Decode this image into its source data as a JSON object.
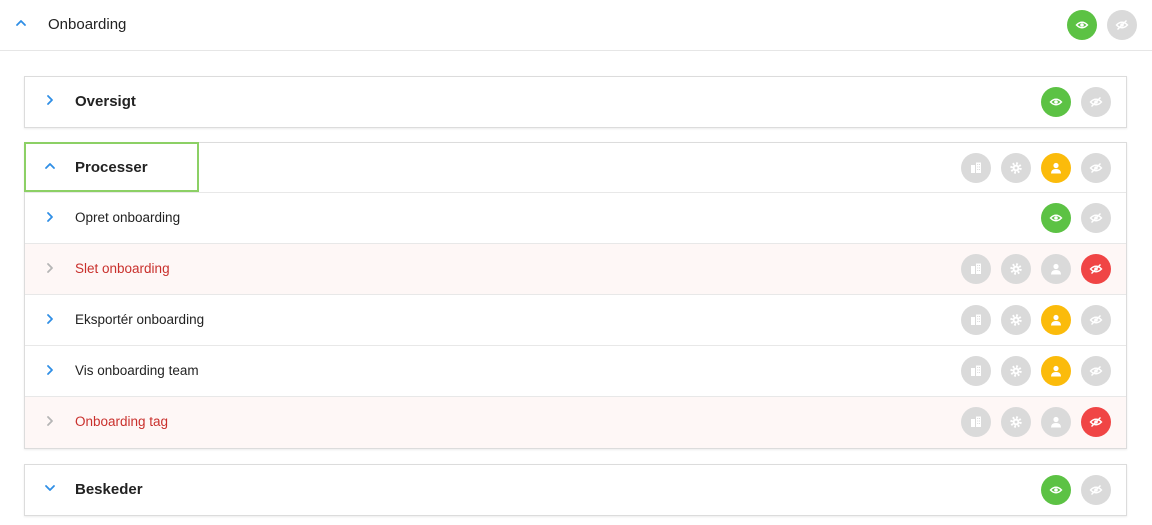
{
  "header": {
    "title": "Onboarding",
    "expanded": true,
    "buttons": [
      "eye-on",
      "eye-off"
    ],
    "states": [
      "active",
      "inactive"
    ]
  },
  "colors": {
    "green": "#5cc244",
    "yellow": "#fbbb0b",
    "red": "#f04545",
    "grey": "#dadada",
    "blue": "#2f8ee6",
    "focus": "#8cd065",
    "denied_text": "#c9302c"
  },
  "sections": [
    {
      "title": "Oversigt",
      "expanded": false,
      "buttons": [
        {
          "icon": "eye-on",
          "state": "green"
        },
        {
          "icon": "eye-off",
          "state": "grey"
        }
      ]
    },
    {
      "title": "Processer",
      "expanded": true,
      "focused": true,
      "buttons": [
        {
          "icon": "building",
          "state": "grey"
        },
        {
          "icon": "gear",
          "state": "grey"
        },
        {
          "icon": "user",
          "state": "yellow"
        },
        {
          "icon": "eye-off",
          "state": "grey"
        }
      ],
      "items": [
        {
          "label": "Opret onboarding",
          "denied": false,
          "buttons": [
            {
              "icon": "eye-on",
              "state": "green"
            },
            {
              "icon": "eye-off",
              "state": "grey"
            }
          ]
        },
        {
          "label": "Slet onboarding",
          "denied": true,
          "buttons": [
            {
              "icon": "building",
              "state": "grey"
            },
            {
              "icon": "gear",
              "state": "grey"
            },
            {
              "icon": "user",
              "state": "grey"
            },
            {
              "icon": "eye-off",
              "state": "red"
            }
          ]
        },
        {
          "label": "Eksportér onboarding",
          "denied": false,
          "buttons": [
            {
              "icon": "building",
              "state": "grey"
            },
            {
              "icon": "gear",
              "state": "grey"
            },
            {
              "icon": "user",
              "state": "yellow"
            },
            {
              "icon": "eye-off",
              "state": "grey"
            }
          ]
        },
        {
          "label": "Vis onboarding team",
          "denied": false,
          "buttons": [
            {
              "icon": "building",
              "state": "grey"
            },
            {
              "icon": "gear",
              "state": "grey"
            },
            {
              "icon": "user",
              "state": "yellow"
            },
            {
              "icon": "eye-off",
              "state": "grey"
            }
          ]
        },
        {
          "label": "Onboarding tag",
          "denied": true,
          "buttons": [
            {
              "icon": "building",
              "state": "grey"
            },
            {
              "icon": "gear",
              "state": "grey"
            },
            {
              "icon": "user",
              "state": "grey"
            },
            {
              "icon": "eye-off",
              "state": "red"
            }
          ]
        }
      ]
    },
    {
      "title": "Beskeder",
      "expanded": false,
      "chevron": "down",
      "buttons": [
        {
          "icon": "eye-on",
          "state": "green"
        },
        {
          "icon": "eye-off",
          "state": "grey"
        }
      ]
    }
  ]
}
